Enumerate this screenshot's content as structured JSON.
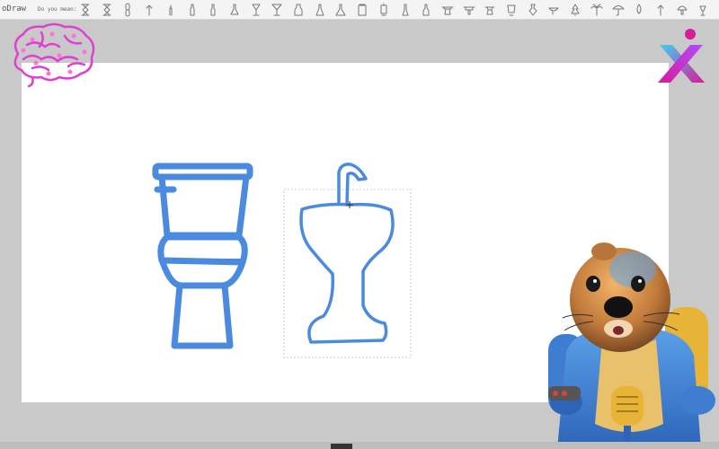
{
  "app": {
    "title": "oDraw"
  },
  "toolbar": {
    "did_you_mean_label": "Do you mean:",
    "suggestions": [
      {
        "name": "hourglass-suggestion-icon"
      },
      {
        "name": "hourglass-2-suggestion-icon"
      },
      {
        "name": "chain-link-suggestion-icon"
      },
      {
        "name": "arrow-up-suggestion-icon"
      },
      {
        "name": "candle-suggestion-icon"
      },
      {
        "name": "bottle-suggestion-icon"
      },
      {
        "name": "bottle-2-suggestion-icon"
      },
      {
        "name": "flask-suggestion-icon"
      },
      {
        "name": "wine-glass-suggestion-icon"
      },
      {
        "name": "cocktail-glass-suggestion-icon"
      },
      {
        "name": "vase-suggestion-icon"
      },
      {
        "name": "flask-2-suggestion-icon"
      },
      {
        "name": "conical-flask-suggestion-icon"
      },
      {
        "name": "jar-suggestion-icon"
      },
      {
        "name": "lantern-suggestion-icon"
      },
      {
        "name": "flask-3-suggestion-icon"
      },
      {
        "name": "bottle-3-suggestion-icon"
      },
      {
        "name": "anvil-suggestion-icon"
      },
      {
        "name": "anvil-2-suggestion-icon"
      },
      {
        "name": "anvil-3-suggestion-icon"
      },
      {
        "name": "cup-suggestion-icon"
      },
      {
        "name": "vase-2-suggestion-icon"
      },
      {
        "name": "bowl-suggestion-icon"
      },
      {
        "name": "tree-suggestion-icon"
      },
      {
        "name": "palm-tree-suggestion-icon"
      },
      {
        "name": "umbrella-suggestion-icon"
      },
      {
        "name": "drop-suggestion-icon"
      },
      {
        "name": "arrow-up-2-suggestion-icon"
      },
      {
        "name": "mushroom-suggestion-icon"
      },
      {
        "name": "lamp-suggestion-icon"
      }
    ]
  },
  "canvas": {
    "stroke_color": "#4a8be0",
    "selection_box_color": "#bdbdbd"
  },
  "colors": {
    "background": "#c9c9c9",
    "paper": "#ffffff",
    "brain_logo": "#e040d0",
    "x_logo_magenta": "#d81b9a",
    "x_logo_cyan": "#3fd0f0"
  }
}
